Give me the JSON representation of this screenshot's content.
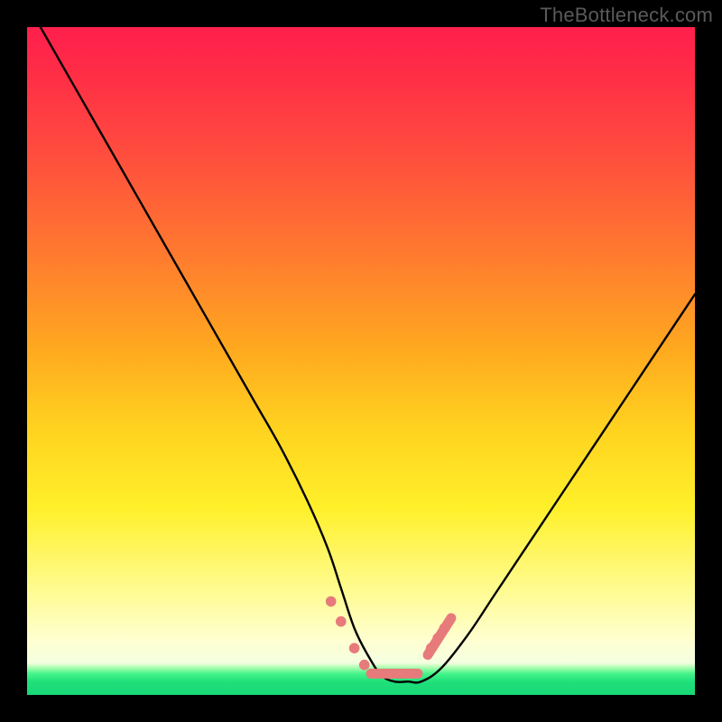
{
  "watermark": "TheBottleneck.com",
  "chart_data": {
    "type": "line",
    "title": "",
    "xlabel": "",
    "ylabel": "",
    "xlim": [
      0,
      100
    ],
    "ylim": [
      0,
      100
    ],
    "series": [
      {
        "name": "bottleneck-curve",
        "x": [
          2,
          6,
          10,
          14,
          18,
          22,
          26,
          30,
          34,
          38,
          42,
          45,
          47,
          49,
          51,
          53,
          55,
          57,
          59,
          62,
          66,
          70,
          74,
          78,
          82,
          86,
          90,
          94,
          98,
          100
        ],
        "values": [
          100,
          93,
          86,
          79,
          72,
          65,
          58,
          51,
          44,
          37,
          29,
          22,
          16,
          10,
          6,
          3,
          2,
          2,
          2,
          4,
          9,
          15,
          21,
          27,
          33,
          39,
          45,
          51,
          57,
          60
        ]
      }
    ],
    "markers": {
      "name": "highlight-dots",
      "color": "#e77a7a",
      "points": [
        {
          "x": 45.5,
          "y": 14
        },
        {
          "x": 47.0,
          "y": 11
        },
        {
          "x": 49.0,
          "y": 7
        },
        {
          "x": 50.5,
          "y": 4.5
        },
        {
          "x": 60.5,
          "y": 7
        },
        {
          "x": 61.5,
          "y": 8.5
        },
        {
          "x": 62.5,
          "y": 10
        }
      ],
      "segments": [
        {
          "x1": 51.5,
          "y1": 3.2,
          "x2": 58.5,
          "y2": 3.2
        },
        {
          "x1": 60.0,
          "y1": 6.0,
          "x2": 63.5,
          "y2": 11.5
        }
      ]
    }
  }
}
